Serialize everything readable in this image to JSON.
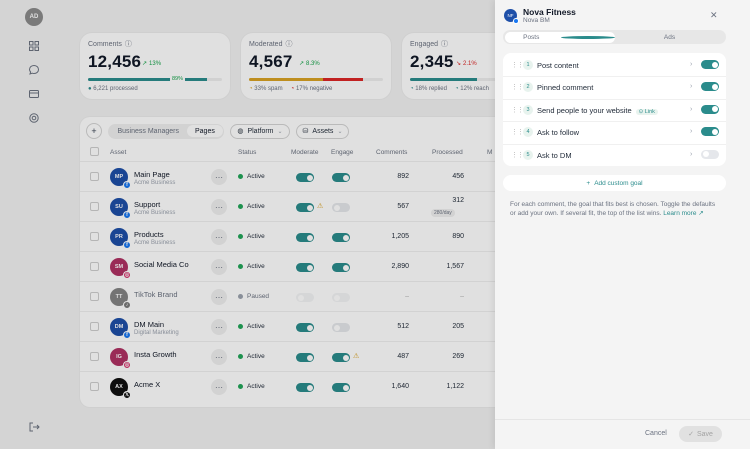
{
  "rail": {
    "avatar": "AD"
  },
  "cards": [
    {
      "label": "Comments",
      "value": "12,456",
      "delta": "13%",
      "delta_dir": "up",
      "pct": "89%",
      "fill": 0.89,
      "foot": [
        "6,221 processed"
      ]
    },
    {
      "label": "Moderated",
      "value": "4,567",
      "delta": "8.3%",
      "delta_dir": "up",
      "fill": 0.7,
      "foot": [
        "33% spam",
        "17% negative"
      ]
    },
    {
      "label": "Engaged",
      "value": "2,345",
      "delta": "2.1%",
      "delta_dir": "down",
      "fill": 0.5,
      "foot": [
        "18% replied",
        "12% reach"
      ]
    }
  ],
  "toolbar": {
    "tabs": [
      "Business Managers",
      "Pages"
    ],
    "active_tab": "Pages",
    "platform": "Platform",
    "assets": "Assets"
  },
  "table": {
    "headers": {
      "asset": "Asset",
      "status": "Status",
      "moderate": "Moderate",
      "engage": "Engage",
      "comments": "Comments",
      "processed": "Processed",
      "m": "M"
    },
    "rows": [
      {
        "initials": "MP",
        "color": "#1e4fa8",
        "platform": "fb",
        "name": "Main Page",
        "sub": "Acme Business",
        "status": "Active",
        "moderate": true,
        "engage": true,
        "warn": false,
        "comments": "892",
        "processed": "456"
      },
      {
        "initials": "SU",
        "color": "#1e4fa8",
        "platform": "fb",
        "name": "Support",
        "sub": "Acme Business",
        "status": "Active",
        "moderate": true,
        "engage": false,
        "warn": "moderate",
        "comments": "567",
        "processed": "312",
        "chip": "280/day"
      },
      {
        "initials": "PR",
        "color": "#1e4fa8",
        "platform": "fb",
        "name": "Products",
        "sub": "Acme Business",
        "status": "Active",
        "moderate": true,
        "engage": true,
        "warn": false,
        "comments": "1,205",
        "processed": "890"
      },
      {
        "initials": "SM",
        "color": "#b03163",
        "platform": "ig",
        "name": "Social Media Co",
        "sub": "",
        "status": "Active",
        "moderate": true,
        "engage": true,
        "warn": false,
        "comments": "2,890",
        "processed": "1,567"
      },
      {
        "initials": "TT",
        "color": "#333333",
        "platform": "tt",
        "name": "TikTok Brand",
        "sub": "",
        "status": "Paused",
        "moderate": false,
        "engage": false,
        "warn": false,
        "comments": "–",
        "processed": "–",
        "dim": true
      },
      {
        "initials": "DM",
        "color": "#1e4fa8",
        "platform": "fb",
        "name": "DM Main",
        "sub": "Digital Marketing",
        "status": "Active",
        "moderate": true,
        "engage": false,
        "warn": false,
        "comments": "512",
        "processed": "205"
      },
      {
        "initials": "IG",
        "color": "#b03163",
        "platform": "ig",
        "name": "Insta Growth",
        "sub": "",
        "status": "Active",
        "moderate": true,
        "engage": true,
        "warn": "engage",
        "comments": "487",
        "processed": "269"
      },
      {
        "initials": "AX",
        "color": "#111111",
        "platform": "x",
        "name": "Acme X",
        "sub": "",
        "status": "Active",
        "moderate": true,
        "engage": true,
        "warn": false,
        "comments": "1,640",
        "processed": "1,122"
      }
    ]
  },
  "panel": {
    "avatar": "NF",
    "title": "Nova Fitness",
    "subtitle": "Nova BM",
    "tabs": [
      "Posts",
      "Ads"
    ],
    "active_tab": "Posts",
    "goals": [
      {
        "n": "1",
        "label": "Post content",
        "on": true
      },
      {
        "n": "2",
        "label": "Pinned comment",
        "on": true
      },
      {
        "n": "3",
        "label": "Send people to your website",
        "badge": "Link",
        "on": true
      },
      {
        "n": "4",
        "label": "Ask to follow",
        "on": true
      },
      {
        "n": "5",
        "label": "Ask to DM",
        "on": false
      }
    ],
    "add_goal": "Add custom goal",
    "help": "For each comment, the goal that fits best is chosen. Toggle the defaults or add your own. If several fit, the top of the list wins.",
    "learn_more": "Learn more",
    "cancel": "Cancel",
    "save": "Save"
  },
  "colors": {
    "accent": "#2b8c8c",
    "active": "#22a559",
    "paused": "#9ca3af",
    "warning": "#d9a224",
    "negative": "#dc2626"
  }
}
